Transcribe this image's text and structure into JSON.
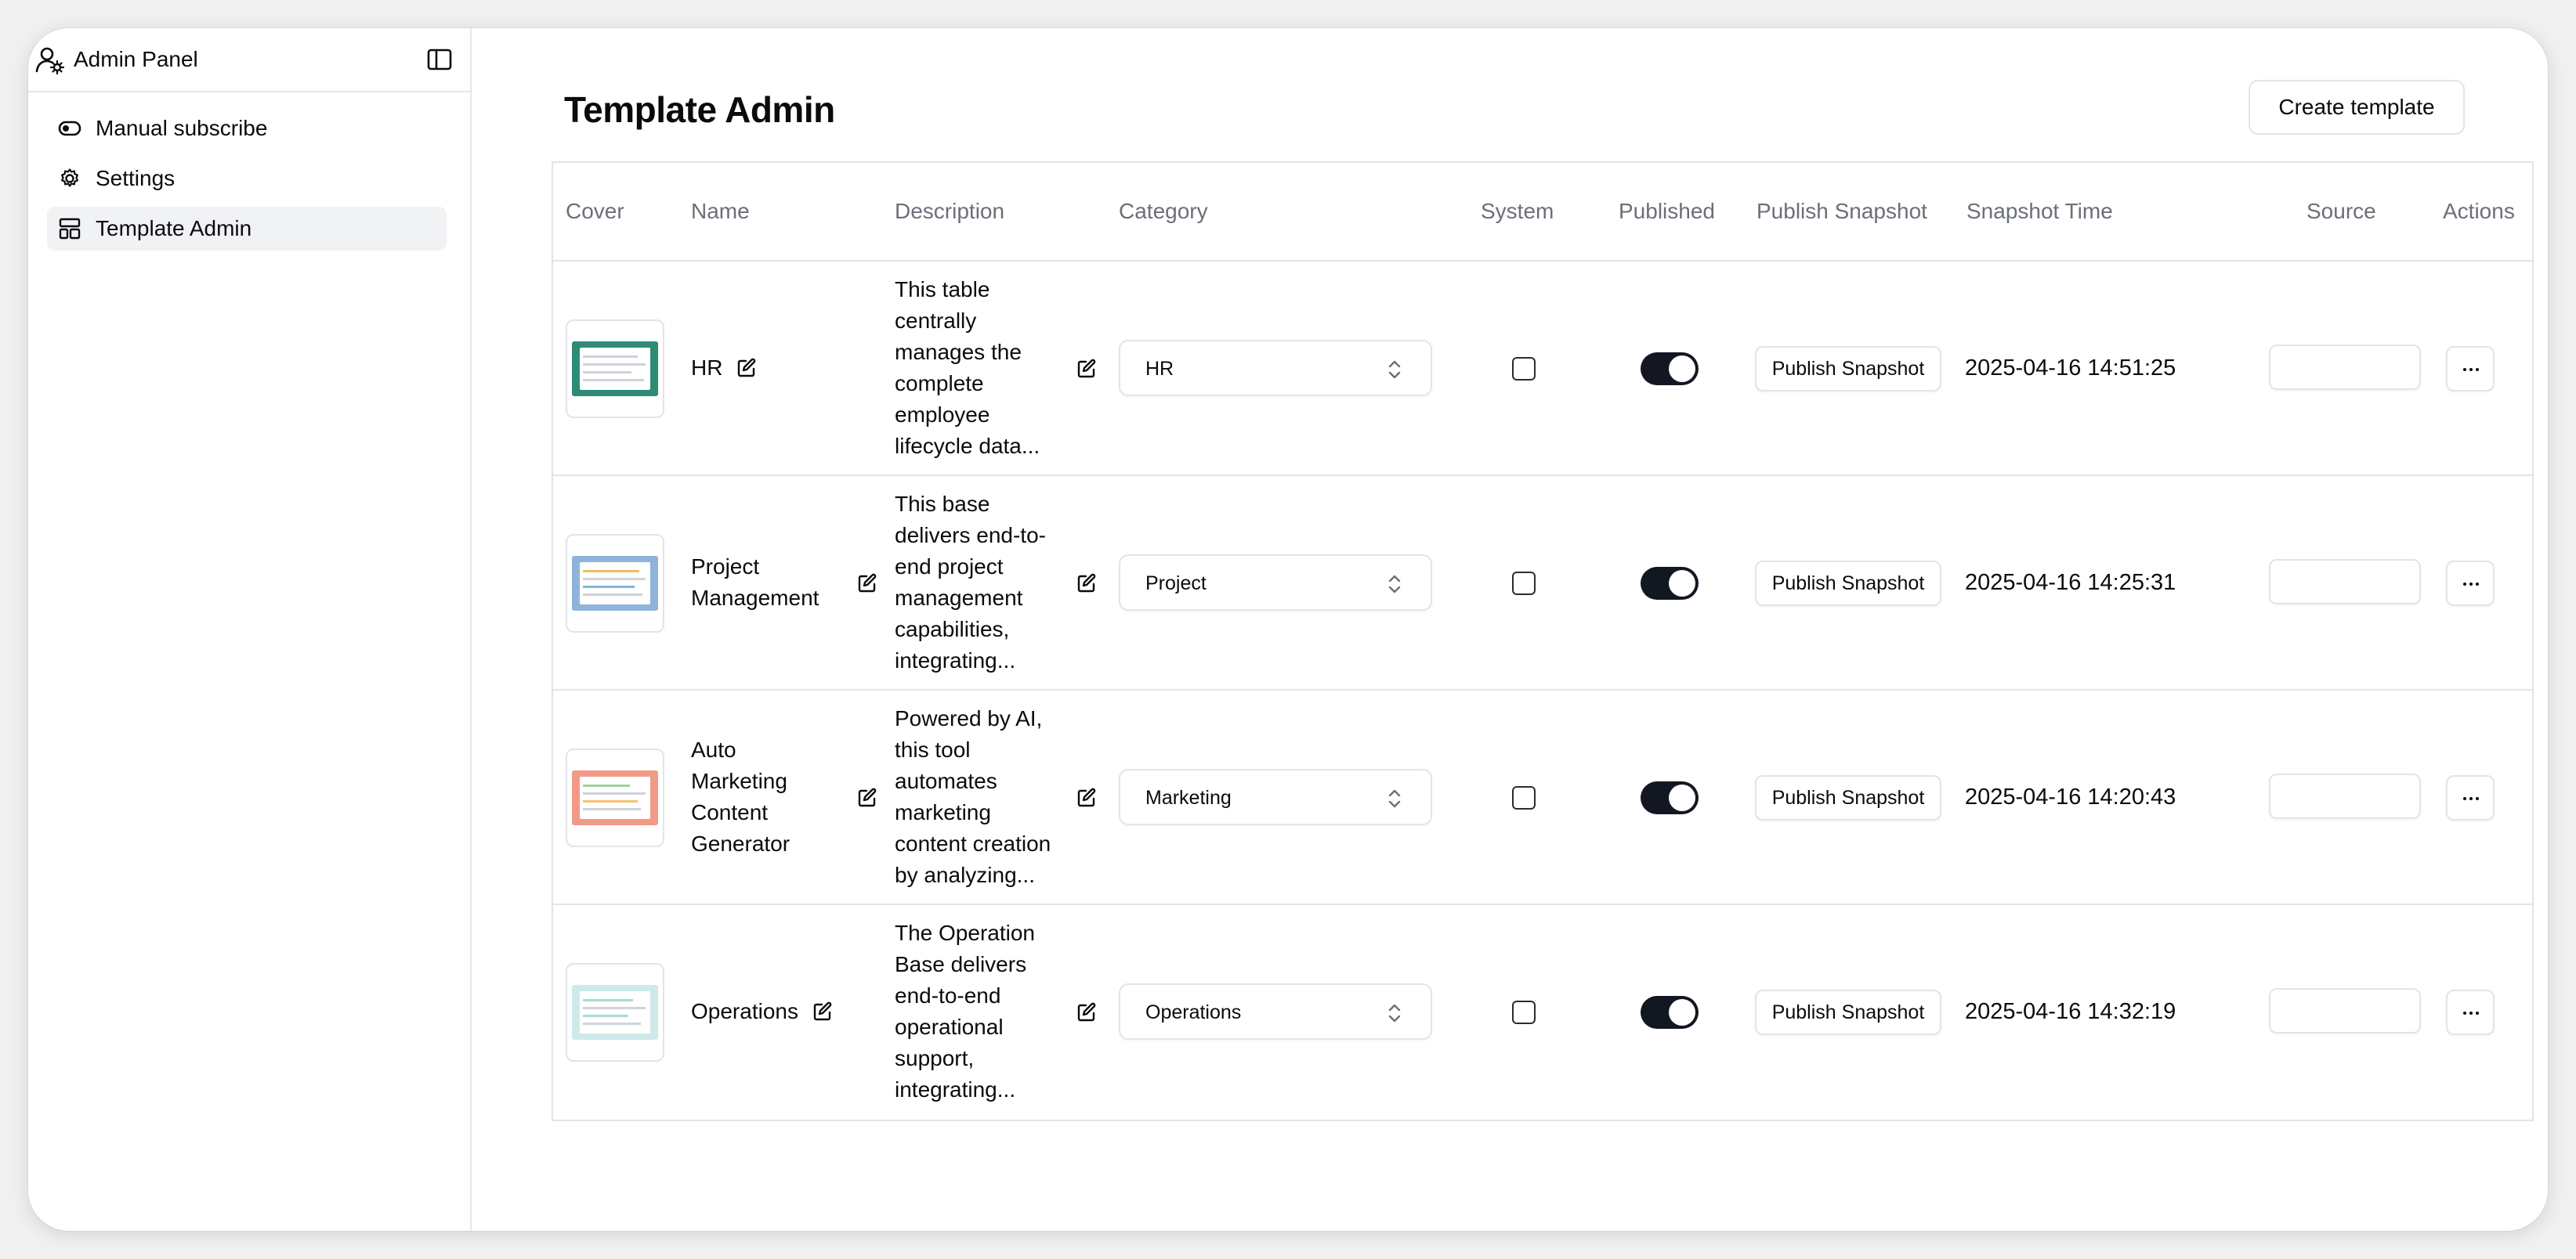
{
  "sidebar": {
    "title": "Admin Panel",
    "items": [
      {
        "label": "Manual subscribe",
        "icon": "toggle-icon",
        "active": false
      },
      {
        "label": "Settings",
        "icon": "gear-icon",
        "active": false
      },
      {
        "label": "Template Admin",
        "icon": "layout-icon",
        "active": true
      }
    ]
  },
  "main": {
    "title": "Template Admin",
    "create_label": "Create template"
  },
  "table": {
    "columns": [
      "Cover",
      "Name",
      "Description",
      "Category",
      "System",
      "Published",
      "Publish Snapshot",
      "Snapshot Time",
      "Source",
      "Actions"
    ],
    "rows": [
      {
        "name": "HR",
        "description": "This table centrally manages the complete employee lifecycle data...",
        "category": "HR",
        "system": false,
        "published": true,
        "snapshot_label": "Publish Snapshot",
        "snapshot_time": "2025-04-16 14:51:25",
        "source": "",
        "cover_color": "#2e8b75"
      },
      {
        "name": "Project Management",
        "description": "This base delivers end-to-end project management capabilities, integrating...",
        "category": "Project",
        "system": false,
        "published": true,
        "snapshot_label": "Publish Snapshot",
        "snapshot_time": "2025-04-16 14:25:31",
        "source": "",
        "cover_color": "#8fb3d9"
      },
      {
        "name": "Auto Marketing Content Generator",
        "description": "Powered by AI, this tool automates marketing content creation by analyzing...",
        "category": "Marketing",
        "system": false,
        "published": true,
        "snapshot_label": "Publish Snapshot",
        "snapshot_time": "2025-04-16 14:20:43",
        "source": "",
        "cover_color": "#f29a88"
      },
      {
        "name": "Operations",
        "description": "The Operation Base delivers end-to-end operational support, integrating...",
        "category": "Operations",
        "system": false,
        "published": true,
        "snapshot_label": "Publish Snapshot",
        "snapshot_time": "2025-04-16 14:32:19",
        "source": "",
        "cover_color": "#cfe9ea"
      }
    ]
  },
  "colors": {
    "accent_dark": "#131722",
    "muted_text": "#6b6f78",
    "border": "#e3e4e8",
    "active_bg": "#f1f2f4"
  }
}
